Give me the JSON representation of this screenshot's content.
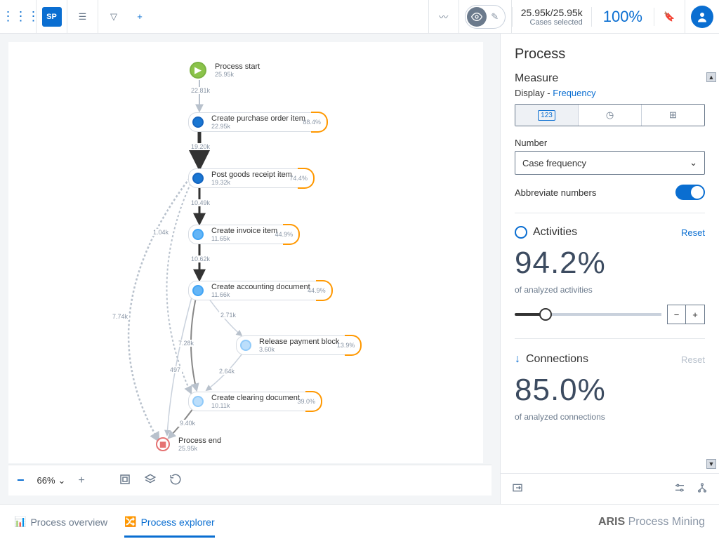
{
  "topbar": {
    "sp_badge": "SP",
    "cases_numbers": "25.95k/25.95k",
    "cases_label": "Cases selected",
    "percent": "100%"
  },
  "canvas": {
    "zoom": "66%",
    "nodes": {
      "start": {
        "title": "Process start",
        "sub": "25.95k"
      },
      "n1": {
        "title": "Create purchase order item",
        "sub": "22.95k",
        "pct": "88.4%"
      },
      "n2": {
        "title": "Post goods receipt item",
        "sub": "19.32k",
        "pct": "74.4%"
      },
      "n3": {
        "title": "Create invoice item",
        "sub": "11.65k",
        "pct": "44.9%"
      },
      "n4": {
        "title": "Create accounting document",
        "sub": "11.66k",
        "pct": "44.9%"
      },
      "n5": {
        "title": "Release payment block",
        "sub": "3.60k",
        "pct": "13.9%"
      },
      "n6": {
        "title": "Create clearing document",
        "sub": "10.11k",
        "pct": "39.0%"
      },
      "end": {
        "title": "Process end",
        "sub": "25.95k"
      }
    },
    "edges": {
      "e0": "22.81k",
      "e1": "19.20k",
      "e2": "10.49k",
      "e3": "10.62k",
      "e4": "2.71k",
      "e5": "2.64k",
      "e6": "7.28k",
      "e7": "9.40k",
      "e8": "497",
      "e9": "1.04k",
      "e10": "7.74k"
    }
  },
  "panel": {
    "title": "Process",
    "measure_label": "Measure",
    "display_label": "Display - ",
    "display_value": "Frequency",
    "number_label": "Number",
    "number_select": "Case frequency",
    "abbrev_label": "Abbreviate numbers",
    "activities_label": "Activities",
    "activities_reset": "Reset",
    "activities_pct": "94.2%",
    "activities_sub": "of analyzed activities",
    "connections_label": "Connections",
    "connections_reset": "Reset",
    "connections_pct": "85.0%",
    "connections_sub": "of analyzed connections"
  },
  "tabs": {
    "overview": "Process overview",
    "explorer": "Process explorer"
  },
  "branding": {
    "aris": "ARIS",
    "rest": " Process Mining"
  }
}
